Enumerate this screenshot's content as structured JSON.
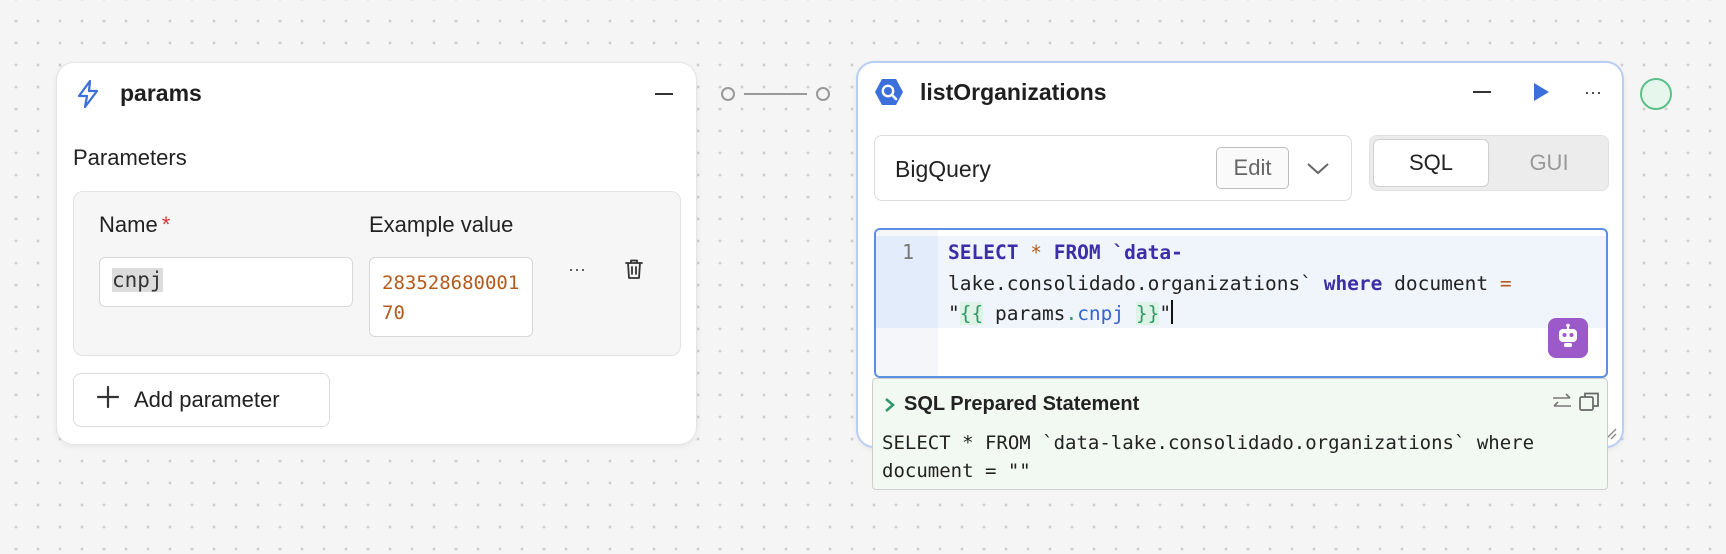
{
  "params_node": {
    "title": "params",
    "section_label": "Parameters",
    "columns": {
      "name": "Name",
      "required_mark": "*",
      "example": "Example value"
    },
    "param": {
      "name": "cnpj",
      "example_value": "28352868000170"
    },
    "more_label": "···",
    "add_label": "Add parameter"
  },
  "query_node": {
    "title": "listOrganizations",
    "resource": "BigQuery",
    "edit_label": "Edit",
    "mode_sql": "SQL",
    "mode_gui": "GUI",
    "more_label": "···",
    "line_number": "1",
    "code": {
      "t1": "SELECT",
      "t2": "*",
      "t3": "FROM",
      "t4": "`data-",
      "t5": "lake.consolidado.organizations`",
      "t6": "where",
      "t7": "document",
      "t8": "=",
      "t9": "\"",
      "t10": "{{",
      "t11": "params",
      "t12": ".",
      "t13": "cnpj",
      "t14": "}}",
      "t15": "\""
    },
    "prepared_title": "SQL Prepared Statement",
    "prepared_statement": "SELECT * FROM `data-lake.consolidado.organizations` where document = \"\""
  },
  "colors": {
    "accent": "#5b8fe0",
    "keyword": "#3d2ea8",
    "template": "#2e9a6a",
    "status": "#5cc08a",
    "ai": "#9b59c9"
  }
}
